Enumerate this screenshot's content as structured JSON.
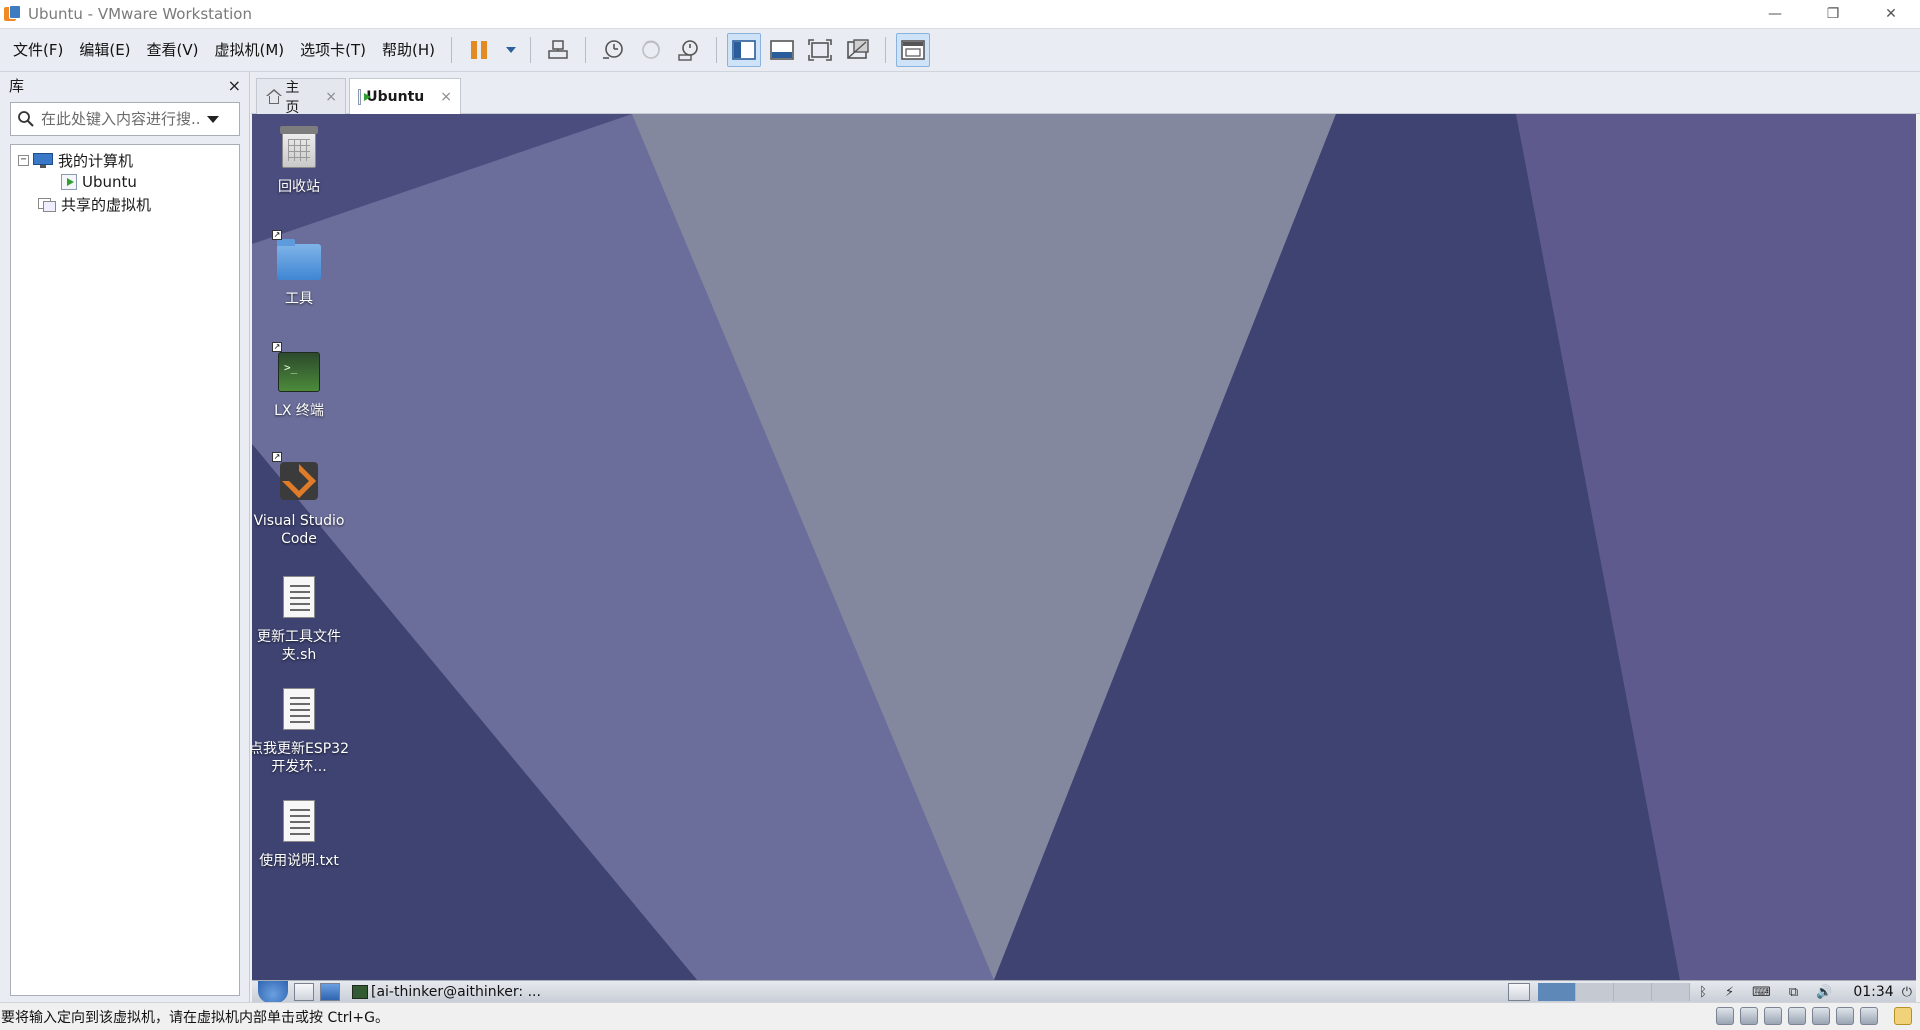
{
  "window": {
    "title": "Ubuntu - VMware Workstation"
  },
  "menu": [
    "文件(F)",
    "编辑(E)",
    "查看(V)",
    "虚拟机(M)",
    "选项卡(T)",
    "帮助(H)"
  ],
  "toolbar": {
    "icons": [
      "pause-icon",
      "send-ctrl-alt-del-icon",
      "snapshot-icon",
      "revert-snapshot-icon",
      "snapshot-manager-icon",
      "show-library-icon",
      "thumbnail-bar-icon",
      "fullscreen-icon",
      "unity-icon",
      "console-view-icon"
    ]
  },
  "library": {
    "title": "库",
    "close": "×",
    "search_placeholder": "在此处键入内容进行搜...",
    "tree": {
      "my_computer": "我的计算机",
      "vm": "Ubuntu",
      "shared": "共享的虚拟机"
    }
  },
  "tabs": [
    {
      "label": "主页",
      "close": "×"
    },
    {
      "label": "Ubuntu",
      "close": "×"
    }
  ],
  "desktop": {
    "icons": [
      {
        "label": "回收站",
        "icon": "trash-icon"
      },
      {
        "label": "工具",
        "icon": "folder-icon"
      },
      {
        "label": "LX 终端",
        "icon": "terminal-icon"
      },
      {
        "label": "Visual Studio Code",
        "icon": "vscode-icon"
      },
      {
        "label": "更新工具文件夹.sh",
        "icon": "script-file-icon"
      },
      {
        "label": "点我更新ESP32开发环...",
        "icon": "script-file-icon"
      },
      {
        "label": "使用说明.txt",
        "icon": "text-file-icon"
      }
    ],
    "bg_colors": [
      "#4a4d7e",
      "#6b6e9a",
      "#84889f",
      "#3e4372",
      "#5e5a8e"
    ]
  },
  "guest_taskbar": {
    "task_label": "[ai-thinker@aithinker: ...",
    "clock": "01:34",
    "tray": {
      "bluetooth": "ᛒ",
      "power": "⚡",
      "keyboard": "⌨",
      "network": "⧉",
      "volume": "🔊",
      "shutdown": "⏻"
    }
  },
  "status": {
    "message": "要将输入定向到该虚拟机，请在虚拟机内部单击或按 Ctrl+G。"
  },
  "window_controls": {
    "minimize": "—",
    "restore": "❐",
    "close": "✕"
  }
}
